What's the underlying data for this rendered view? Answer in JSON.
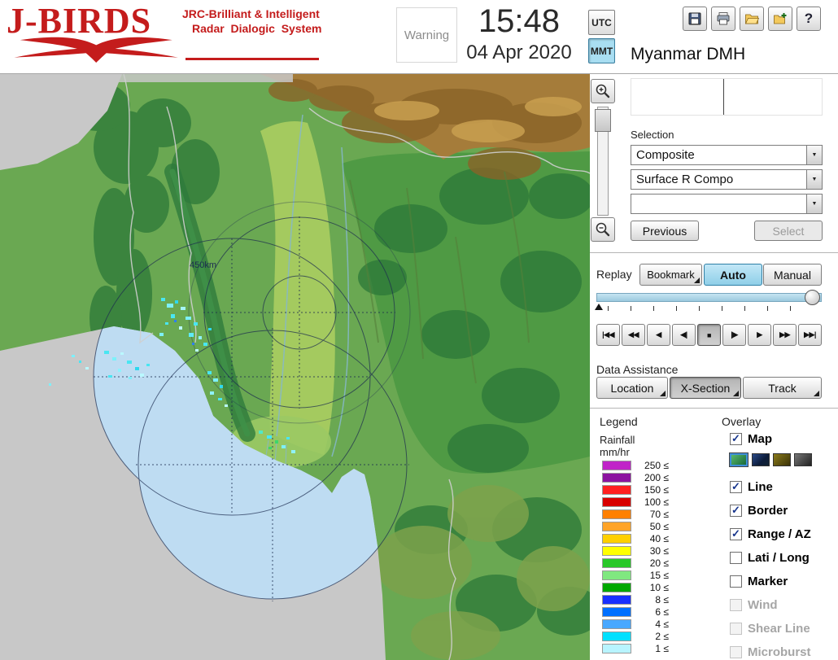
{
  "header": {
    "logo": {
      "title": "J-BIRDS",
      "subtitle_line1": "JRC-Brilliant & Intelligent",
      "subtitle_line2": "Radar  Dialogic  System"
    },
    "warning_label": "Warning",
    "clock": {
      "time": "15:48",
      "date": "04 Apr 2020"
    },
    "timezone": {
      "utc": "UTC",
      "mmt": "MMT",
      "selected": "MMT"
    },
    "org_name": "Myanmar DMH"
  },
  "toolbar": {
    "buttons": [
      "save",
      "print",
      "open",
      "add-window",
      "help"
    ]
  },
  "icons": {
    "check": "✓",
    "dropdown_arrow": "▼",
    "help_glyph": "?"
  },
  "map": {
    "range_ring_label": "450km"
  },
  "selection": {
    "label": "Selection",
    "dropdowns": [
      {
        "value": "Composite"
      },
      {
        "value": "Surface R Compo"
      },
      {
        "value": ""
      }
    ],
    "previous_label": "Previous",
    "select_label": "Select"
  },
  "replay": {
    "label": "Replay",
    "bookmark_label": "Bookmark",
    "auto_label": "Auto",
    "manual_label": "Manual",
    "mode_selected": "Auto",
    "playback": [
      "|◀◀",
      "◀◀",
      "◀",
      "◀|",
      "■",
      "|▶",
      "▶",
      "▶▶",
      "▶▶|"
    ]
  },
  "data_assistance": {
    "label": "Data Assistance",
    "buttons": [
      "Location",
      "X-Section",
      "Track"
    ],
    "pressed": "X-Section"
  },
  "legend": {
    "title": "Legend",
    "unit_line1": "Rainfall",
    "unit_line2": "mm/hr",
    "entries": [
      {
        "label": "250 ≤",
        "color": "#c024c8"
      },
      {
        "label": "200 ≤",
        "color": "#8c14a0"
      },
      {
        "label": "150 ≤",
        "color": "#ff2020"
      },
      {
        "label": "100 ≤",
        "color": "#d80000"
      },
      {
        "label": "70 ≤",
        "color": "#ff8000"
      },
      {
        "label": "50 ≤",
        "color": "#ffa428"
      },
      {
        "label": "40 ≤",
        "color": "#ffd000"
      },
      {
        "label": "30 ≤",
        "color": "#ffff00"
      },
      {
        "label": "20 ≤",
        "color": "#28c828"
      },
      {
        "label": "15 ≤",
        "color": "#80e880"
      },
      {
        "label": "10 ≤",
        "color": "#00a800"
      },
      {
        "label": "8 ≤",
        "color": "#1830ff"
      },
      {
        "label": "6 ≤",
        "color": "#0070ff"
      },
      {
        "label": "4 ≤",
        "color": "#48a8ff"
      },
      {
        "label": "2 ≤",
        "color": "#00e0ff"
      },
      {
        "label": "1 ≤",
        "color": "#b8f4ff"
      }
    ]
  },
  "overlay": {
    "title": "Overlay",
    "items": [
      {
        "label": "Map",
        "checked": true,
        "disabled": false
      },
      {
        "label": "Line",
        "checked": true,
        "disabled": false
      },
      {
        "label": "Border",
        "checked": true,
        "disabled": false
      },
      {
        "label": "Range / AZ",
        "checked": true,
        "disabled": false
      },
      {
        "label": "Lati / Long",
        "checked": false,
        "disabled": false
      },
      {
        "label": "Marker",
        "checked": false,
        "disabled": false
      },
      {
        "label": "Wind",
        "checked": false,
        "disabled": true
      },
      {
        "label": "Shear Line",
        "checked": false,
        "disabled": true
      },
      {
        "label": "Microburst",
        "checked": false,
        "disabled": true
      }
    ],
    "map_styles": [
      "green",
      "navy",
      "olive",
      "dark"
    ],
    "map_style_selected": "green"
  }
}
